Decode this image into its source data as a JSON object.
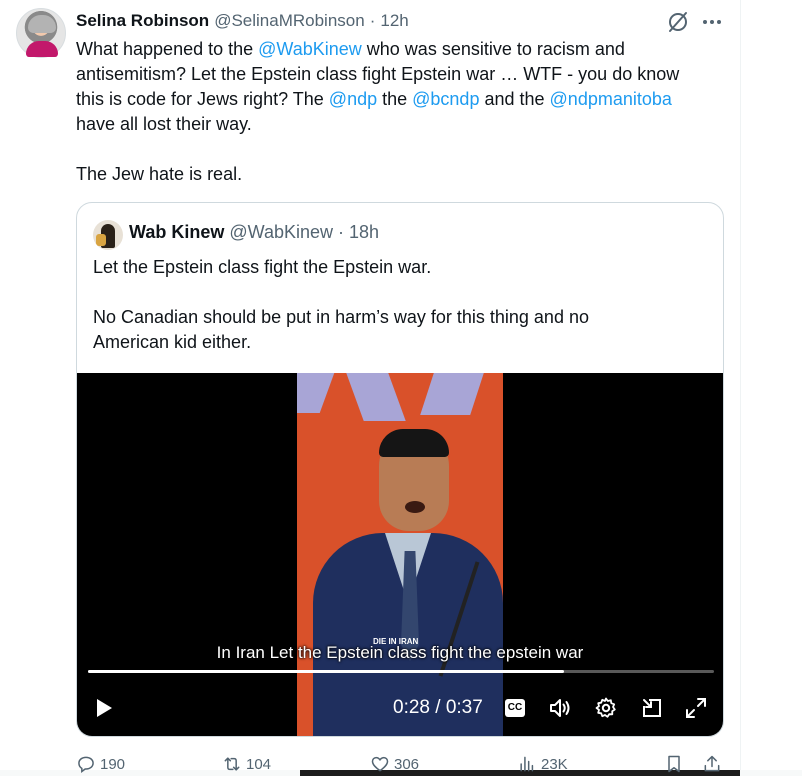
{
  "tweet": {
    "author_name": "Selina Robinson",
    "author_handle": "@SelinaMRobinson",
    "separator": "·",
    "time": "12h",
    "lines": [
      [
        "What happened to the ",
        "@WabKinew",
        " who was sensitive to racism and"
      ],
      [
        "antisemitism? Let the Epstein class fight Epstein war … WTF - you do know"
      ],
      [
        "this is code for Jews right?   The ",
        "@ndp",
        " the ",
        "@bcndp",
        " and the ",
        "@ndpmanitoba"
      ],
      [
        "have all lost their way."
      ]
    ],
    "closing": "The Jew hate is real."
  },
  "quote": {
    "author_name": "Wab Kinew",
    "author_handle": "@WabKinew",
    "separator": "·",
    "time": "18h",
    "text_1": "Let the Epstein class fight the Epstein war.",
    "text_2a": "No Canadian should be put in harm’s way for this thing and no",
    "text_2b": "American kid either."
  },
  "video": {
    "caption": "In Iran Let the Epstein class fight the epstein war",
    "podium_text": "DIE IN IRAN",
    "current_time": "0:28",
    "duration": "0:37",
    "time_display": "0:28 / 0:37",
    "progress": 0.76,
    "cc_label": "CC"
  },
  "actions": {
    "replies": "190",
    "reposts": "104",
    "likes": "306",
    "views": "23K"
  },
  "colors": {
    "accent": "#1d9bf0",
    "text": "#0f1419",
    "secondary": "#536471"
  }
}
